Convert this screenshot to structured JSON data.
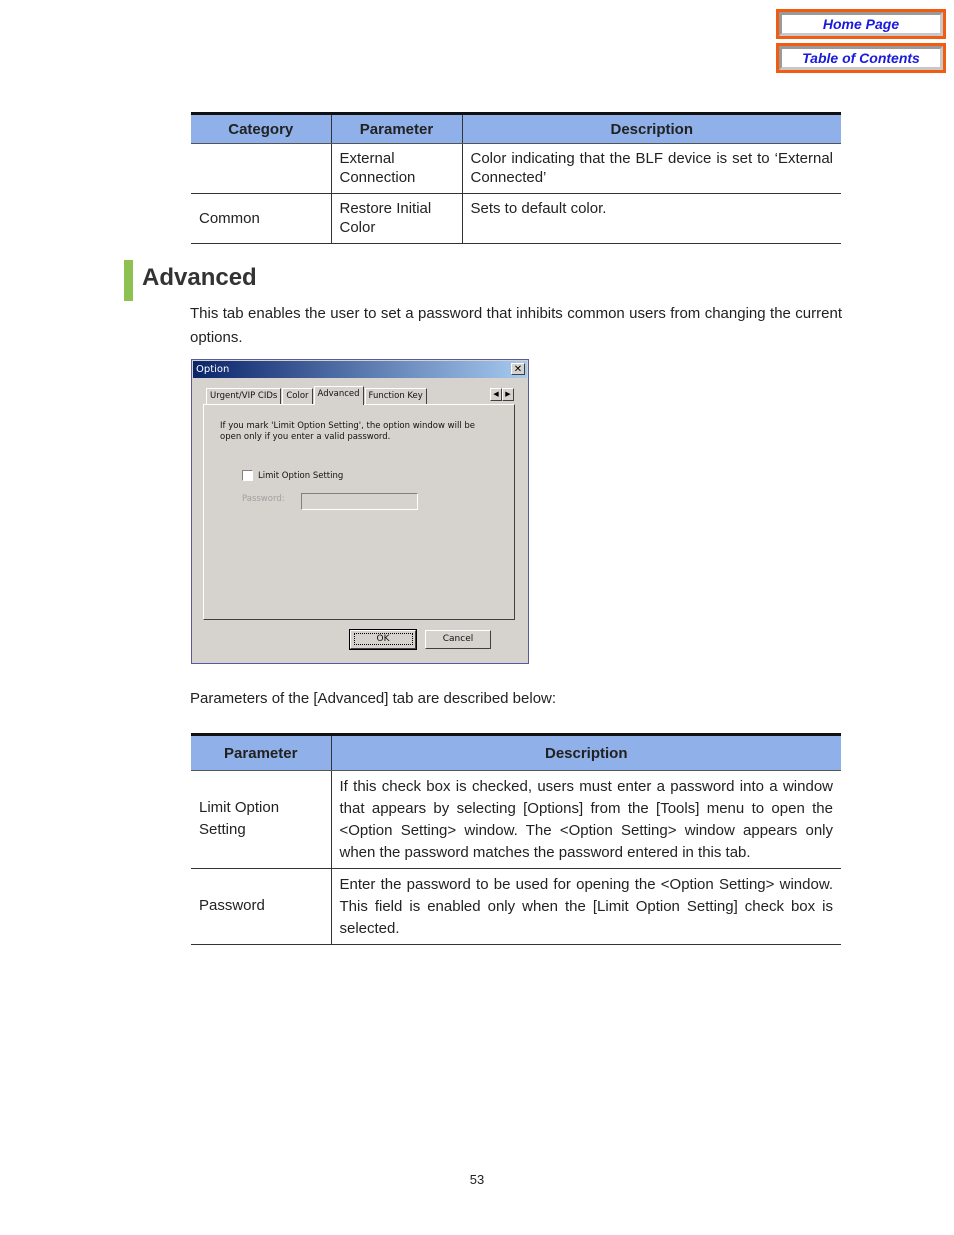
{
  "nav": {
    "home_label": "Home Page",
    "toc_label": "Table of Contents"
  },
  "color_table": {
    "headers": [
      "Category",
      "Parameter",
      "Description"
    ],
    "rows": [
      {
        "category": "",
        "parameter": "External Connection",
        "description": "Color indicating that the BLF device is set to ‘External Connected’"
      },
      {
        "category": "Common",
        "parameter": "Restore Initial Color",
        "description": "Sets to default color."
      }
    ]
  },
  "section": {
    "heading": "Advanced",
    "intro": "This tab enables the user to set a password that inhibits common users from changing the current options.",
    "params_intro": "Parameters of the [Advanced] tab are described below:"
  },
  "dialog": {
    "title": "Option",
    "close_glyph": "✕",
    "tabs": [
      "Urgent/VIP CIDs",
      "Color",
      "Advanced",
      "Function Key"
    ],
    "active_tab": "Advanced",
    "scroll_left": "◀",
    "scroll_right": "▶",
    "info_text": "If you mark 'Limit Option Setting', the option window will be open only if you enter a valid password.",
    "checkbox_label": "Limit Option Setting",
    "checkbox_checked": false,
    "password_label": "Password:",
    "password_value": "",
    "ok_label": "OK",
    "cancel_label": "Cancel"
  },
  "params_table": {
    "headers": [
      "Parameter",
      "Description"
    ],
    "rows": [
      {
        "parameter": "Limit Option Setting",
        "description": "If this check box is checked, users must enter a password into a window that appears by selecting [Options] from the [Tools] menu to open the <Option Setting> window. The <Option Setting> window appears only when the password matches the password entered in this tab."
      },
      {
        "parameter": "Password",
        "description": "Enter the password to be used for opening the <Option Setting> window. This field is enabled only when the [Limit Option Setting] check box is selected."
      }
    ]
  },
  "page_number": "53",
  "colors": {
    "nav_border": "#f25c12",
    "nav_text": "#1a1adc",
    "table_header_bg": "#8fb0e8",
    "heading_accent": "#8dc151"
  }
}
